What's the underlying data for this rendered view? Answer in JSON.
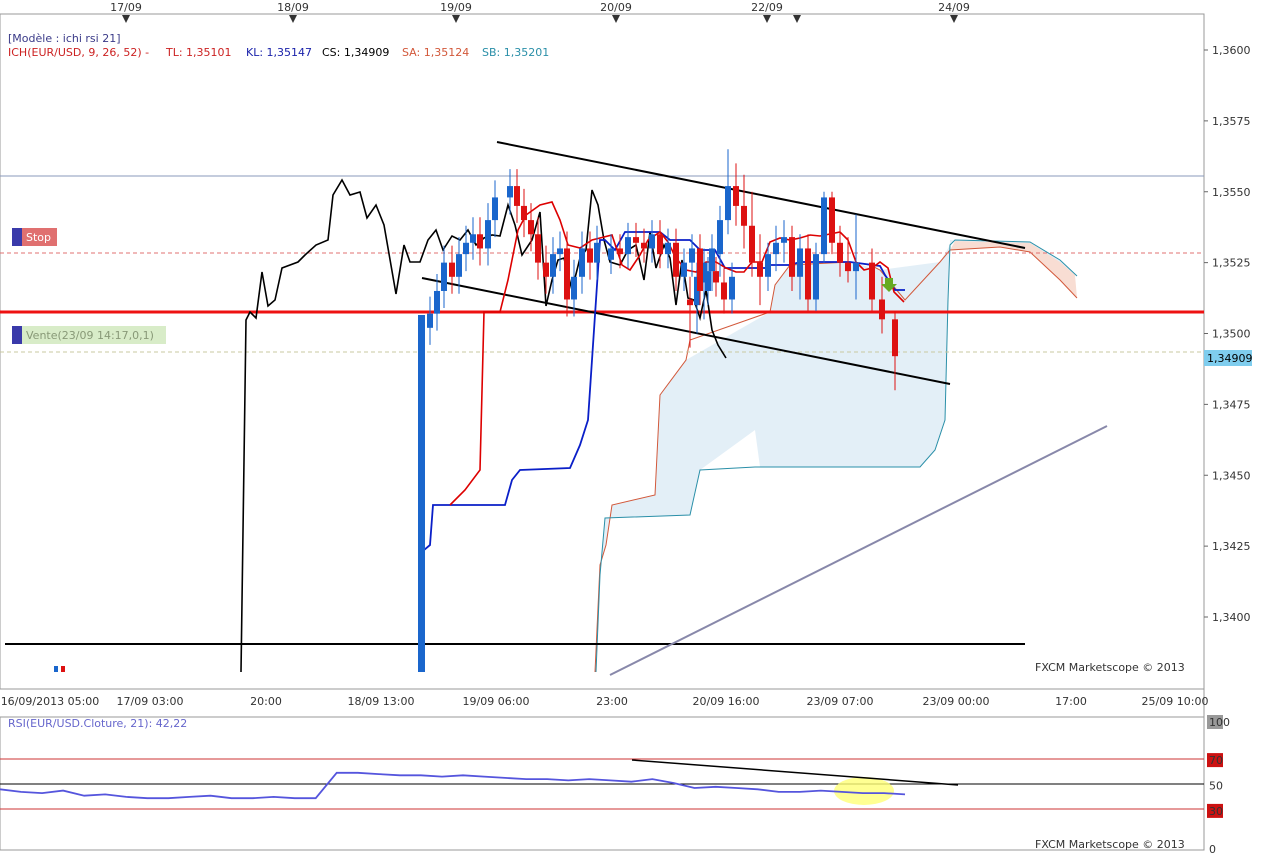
{
  "header": {
    "template_label": "[Modèle : ichi rsi 21]",
    "ichimoku_label": "ICH(EUR/USD, 9, 26, 52) -",
    "tl": "TL: 1,35101",
    "kl": "KL: 1,35147",
    "cs": "CS: 1,34909",
    "sa": "SA: 1,35124",
    "sb": "SB: 1,35201"
  },
  "colors": {
    "tenkan": "#dd0000",
    "kijun": "#0000cc",
    "chikou": "#000000",
    "senkou_a": "#d2583a",
    "senkou_b": "#2a8fa8",
    "cloud_bull": "#e3eff7",
    "cloud_bear": "#f8ddd3",
    "candle_up": "#1a66cc",
    "candle_down": "#dd1111",
    "rsi_line": "#5555dd",
    "current_price_bg": "#7fcdee"
  },
  "annotations": {
    "stop_label": "Stop",
    "vente_label": "Vente(23/09 14:17,0,1)",
    "current_price": "1,34909",
    "watermark": "FXCM Marketscope © 2013",
    "rsi_label": "RSI(EUR/USD.Cloture, 21): 42,22",
    "rsi_watermark": "FXCM Marketscope © 2013"
  },
  "chart_data": [
    {
      "type": "line",
      "title": "EUR/USD",
      "subtitle": "ICH(EUR/USD, 9, 26, 52)",
      "yticks": [
        "1,3600",
        "1,3575",
        "1,3550",
        "1,3525",
        "1,3500",
        "1,3475",
        "1,3450",
        "1,3425",
        "1,3400"
      ],
      "ylim": [
        1.3385,
        1.3615
      ],
      "top_date_labels": [
        "17/09",
        "18/09",
        "19/09",
        "20/09",
        "22/09",
        "24/09"
      ],
      "xticks": [
        "16/09/2013 05:00",
        "17/09 03:00",
        "20:00",
        "18/09 13:00",
        "19/09 06:00",
        "23:00",
        "20/09 16:00",
        "23/09 07:00",
        "23/09 00:00",
        "17:00",
        "25/09 10:00"
      ],
      "horizontal_levels": [
        {
          "name": "Stop",
          "value": 1.3528
        },
        {
          "name": "Vente",
          "value": 1.3508
        },
        {
          "value": 1.3555
        },
        {
          "value": 1.3494
        },
        {
          "value": 1.339
        }
      ],
      "candles": [
        {
          "t": 0,
          "o": 1.3512,
          "h": 1.352,
          "l": 1.3495,
          "c": 1.351
        },
        {
          "t": 1,
          "o": 1.351,
          "h": 1.3525,
          "l": 1.35,
          "c": 1.352
        },
        {
          "t": 2,
          "o": 1.3518,
          "h": 1.353,
          "l": 1.3505,
          "c": 1.3525
        },
        {
          "t": 3,
          "o": 1.3522,
          "h": 1.3535,
          "l": 1.3515,
          "c": 1.353
        },
        {
          "t": 4,
          "o": 1.3528,
          "h": 1.3545,
          "l": 1.352,
          "c": 1.354
        },
        {
          "t": 5,
          "o": 1.354,
          "h": 1.3565,
          "l": 1.3535,
          "c": 1.3552
        },
        {
          "t": 6,
          "o": 1.3552,
          "h": 1.356,
          "l": 1.3538,
          "c": 1.3545
        },
        {
          "t": 7,
          "o": 1.3545,
          "h": 1.3556,
          "l": 1.353,
          "c": 1.3538
        },
        {
          "t": 8,
          "o": 1.3538,
          "h": 1.355,
          "l": 1.352,
          "c": 1.3525
        },
        {
          "t": 9,
          "o": 1.3525,
          "h": 1.3535,
          "l": 1.351,
          "c": 1.352
        },
        {
          "t": 10,
          "o": 1.352,
          "h": 1.3532,
          "l": 1.3515,
          "c": 1.3528
        },
        {
          "t": 11,
          "o": 1.3528,
          "h": 1.3538,
          "l": 1.3522,
          "c": 1.3532
        },
        {
          "t": 12,
          "o": 1.3532,
          "h": 1.354,
          "l": 1.3525,
          "c": 1.3534
        },
        {
          "t": 13,
          "o": 1.3534,
          "h": 1.3538,
          "l": 1.3515,
          "c": 1.352
        },
        {
          "t": 14,
          "o": 1.352,
          "h": 1.3535,
          "l": 1.3512,
          "c": 1.353
        },
        {
          "t": 15,
          "o": 1.353,
          "h": 1.3535,
          "l": 1.3508,
          "c": 1.3512
        },
        {
          "t": 16,
          "o": 1.3512,
          "h": 1.3532,
          "l": 1.3508,
          "c": 1.3528
        },
        {
          "t": 17,
          "o": 1.3528,
          "h": 1.355,
          "l": 1.3525,
          "c": 1.3548
        },
        {
          "t": 18,
          "o": 1.3548,
          "h": 1.355,
          "l": 1.3528,
          "c": 1.3532
        },
        {
          "t": 19,
          "o": 1.3532,
          "h": 1.3538,
          "l": 1.352,
          "c": 1.3525
        },
        {
          "t": 20,
          "o": 1.3525,
          "h": 1.3534,
          "l": 1.3518,
          "c": 1.3522
        },
        {
          "t": 21,
          "o": 1.3522,
          "h": 1.3542,
          "l": 1.3512,
          "c": 1.3525
        },
        {
          "t": 22,
          "o": 1.3525,
          "h": 1.353,
          "l": 1.3508,
          "c": 1.3512
        },
        {
          "t": 23,
          "o": 1.3512,
          "h": 1.352,
          "l": 1.35,
          "c": 1.3505
        },
        {
          "t": 24,
          "o": 1.3505,
          "h": 1.3508,
          "l": 1.348,
          "c": 1.3492
        }
      ],
      "rsi": {
        "name": "RSI(EUR/USD.Cloture, 21)",
        "last_value": 42.22,
        "yticks": [
          "100",
          "70",
          "50",
          "30",
          "0"
        ],
        "levels": [
          70,
          50,
          30
        ],
        "values": [
          47,
          45,
          44,
          46,
          42,
          43,
          41,
          40,
          40,
          41,
          42,
          40,
          40,
          41,
          40,
          40,
          60,
          60,
          59,
          58,
          58,
          57,
          58,
          57,
          56,
          55,
          55,
          54,
          55,
          54,
          53,
          55,
          52,
          48,
          49,
          48,
          47,
          45,
          45,
          46,
          45,
          44,
          44,
          43
        ]
      }
    }
  ]
}
